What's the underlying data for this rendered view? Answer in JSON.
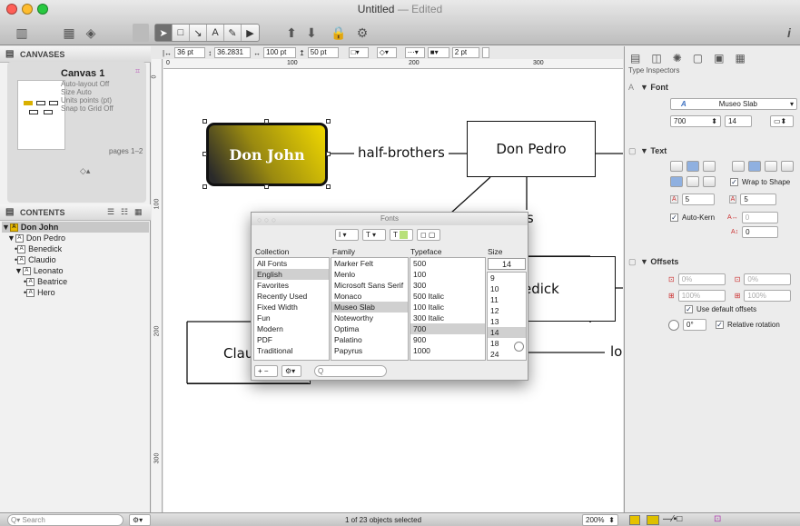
{
  "window": {
    "title": "Untitled",
    "title_suffix": "— Edited"
  },
  "canvases_panel": {
    "header": "CANVASES",
    "canvas_name": "Canvas 1",
    "meta": [
      "Auto-layout Off",
      "Size Auto",
      "Units points (pt)",
      "Snap to Grid Off"
    ],
    "pages": "pages 1–2"
  },
  "contents_panel": {
    "header": "CONTENTS",
    "items": [
      {
        "label": "Don John",
        "level": 0
      },
      {
        "label": "Don Pedro",
        "level": 1
      },
      {
        "label": "Benedick",
        "level": 2
      },
      {
        "label": "Claudio",
        "level": 2
      },
      {
        "label": "Leonato",
        "level": 2
      },
      {
        "label": "Beatrice",
        "level": 3
      },
      {
        "label": "Hero",
        "level": 3
      }
    ]
  },
  "control_bar": {
    "x": "36 pt",
    "y": "36.2831",
    "w": "100 pt",
    "h": "50 pt",
    "stroke": "2 pt"
  },
  "ruler": {
    "h_ticks": [
      "0",
      "100",
      "200",
      "300"
    ],
    "v_ticks": [
      "0",
      "100",
      "200",
      "300"
    ]
  },
  "canvas": {
    "don_john": "Don John",
    "half_brothers": "half-brothers",
    "don_pedro": "Don Pedro",
    "ss": "ss",
    "edick": "edick",
    "clau": "Clau",
    "lo": "lo"
  },
  "inspector": {
    "title": "Type Inspectors",
    "font_header": "Font",
    "font_name": "Museo Slab",
    "weight": "700",
    "size": "14",
    "text_header": "Text",
    "wrap": "Wrap to Shape",
    "spacing_a": "5",
    "spacing_b": "5",
    "auto_kern": "Auto-Kern",
    "kern_value": "0",
    "baseline": "0",
    "offsets_header": "Offsets",
    "off_a": "0%",
    "off_b": "0%",
    "off_c": "100%",
    "off_d": "100%",
    "use_default": "Use default offsets",
    "rotation": "0°",
    "relative_rotation": "Relative rotation"
  },
  "fonts_panel": {
    "title": "Fonts",
    "headers": {
      "collection": "Collection",
      "family": "Family",
      "typeface": "Typeface",
      "size": "Size"
    },
    "collections": [
      "All Fonts",
      "English",
      "Favorites",
      "Recently Used",
      "Fixed Width",
      "Fun",
      "Modern",
      "PDF",
      "Traditional"
    ],
    "families": [
      "Marker Felt",
      "Menlo",
      "Microsoft Sans Serif",
      "Monaco",
      "Museo Slab",
      "Noteworthy",
      "Optima",
      "Palatino",
      "Papyrus"
    ],
    "typefaces": [
      "500",
      "100",
      "300",
      "500 Italic",
      "100 Italic",
      "300 Italic",
      "700",
      "900",
      "1000"
    ],
    "size_value": "14",
    "sizes": [
      "9",
      "10",
      "11",
      "12",
      "13",
      "14",
      "18",
      "24"
    ],
    "search_placeholder": "Q"
  },
  "status": {
    "search_placeholder": "Q▾ Search",
    "selection": "1 of 23 objects selected",
    "zoom": "200%"
  },
  "colors": {
    "selection_gold": "#e6c200",
    "shape_dark": "#222222"
  }
}
